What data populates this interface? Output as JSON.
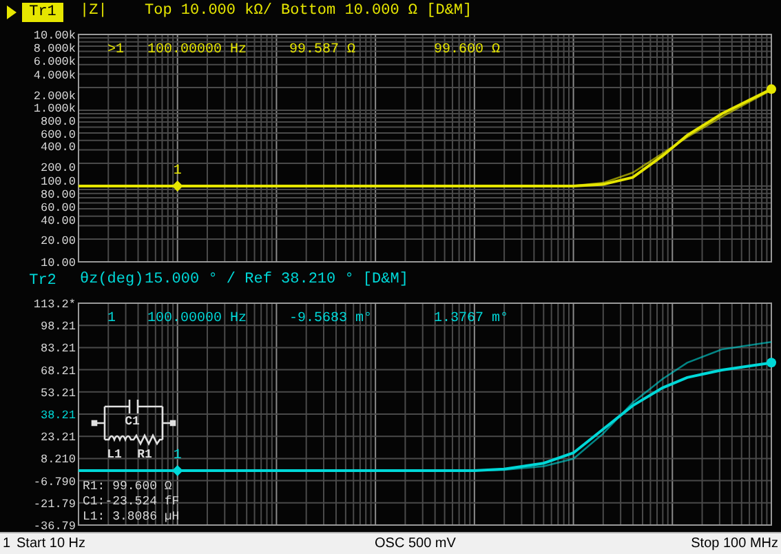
{
  "traces": [
    {
      "name": "Tr1",
      "kind": "magnitude",
      "active": true,
      "color": "#e6e600",
      "format": "|Z|",
      "scale": "Top 10.000 kΩ/ Bottom 10.000 Ω [D&M]",
      "readout": {
        "marker": ">1",
        "frequency": "100.00000 Hz",
        "value": "99.587 Ω",
        "memory_value": "99.600 Ω"
      },
      "marker_label": "1",
      "y_labels": [
        {
          "label": "10.00k",
          "reference": false
        },
        {
          "label": "8.000k",
          "reference": false
        },
        {
          "label": "6.000k",
          "reference": false
        },
        {
          "label": "4.000k",
          "reference": false
        },
        {
          "label": "2.000k",
          "reference": false
        },
        {
          "label": "1.000k",
          "reference": false
        },
        {
          "label": "800.0",
          "reference": false
        },
        {
          "label": "600.0",
          "reference": false
        },
        {
          "label": "400.0",
          "reference": false
        },
        {
          "label": "200.0",
          "reference": false
        },
        {
          "label": "100.0",
          "reference": false
        },
        {
          "label": "80.00",
          "reference": false
        },
        {
          "label": "60.00",
          "reference": false
        },
        {
          "label": "40.00",
          "reference": false
        },
        {
          "label": "20.00",
          "reference": false
        },
        {
          "label": "10.00",
          "reference": false
        }
      ]
    },
    {
      "name": "Tr2",
      "kind": "phase",
      "active": false,
      "color": "#00d8d8",
      "format": "θz(deg)",
      "scale": "15.000 ° / Ref 38.210 ° [D&M]",
      "readout": {
        "marker": "1",
        "frequency": "100.00000 Hz",
        "value": "-9.5683 m°",
        "memory_value": "1.3767 m°"
      },
      "marker_label": "1",
      "y_labels": [
        {
          "label": "113.2*",
          "reference": false
        },
        {
          "label": "98.21",
          "reference": false
        },
        {
          "label": "83.21",
          "reference": false
        },
        {
          "label": "68.21",
          "reference": false
        },
        {
          "label": "53.21",
          "reference": false
        },
        {
          "label": "38.21",
          "reference": true
        },
        {
          "label": "23.21",
          "reference": false
        },
        {
          "label": "8.210",
          "reference": false
        },
        {
          "label": "-6.790",
          "reference": false
        },
        {
          "label": "-21.79",
          "reference": false
        },
        {
          "label": "-36.79",
          "reference": false
        }
      ]
    }
  ],
  "equivalent_circuit": {
    "labels": [
      "C1",
      "L1",
      "R1"
    ],
    "values": [
      "R1: 99.600 Ω",
      "C1:-23.524 fF",
      "L1: 3.8086 µH"
    ]
  },
  "status_bar": {
    "channel": "1",
    "start": "Start 10 Hz",
    "center": "OSC 500 mV",
    "stop": "Stop 100 MHz"
  }
}
